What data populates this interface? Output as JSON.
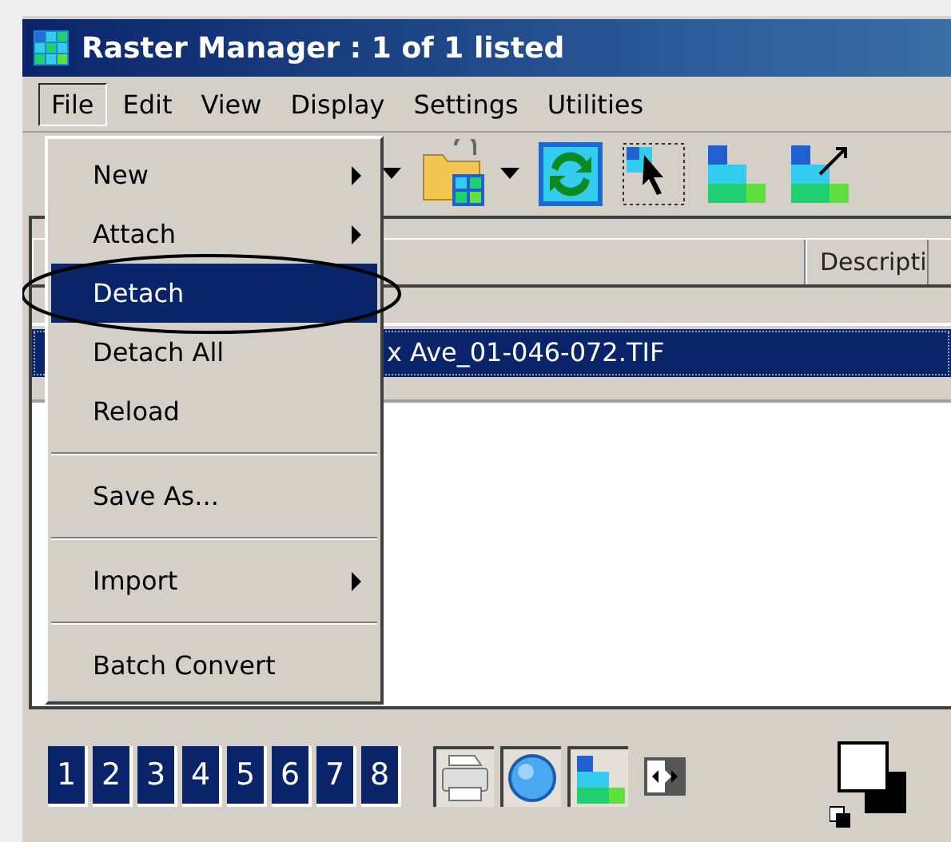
{
  "window": {
    "title": "Raster Manager : 1 of 1 listed"
  },
  "menu_bar": [
    {
      "label": "File",
      "selected": true
    },
    {
      "label": "Edit",
      "selected": false
    },
    {
      "label": "View",
      "selected": false
    },
    {
      "label": "Display",
      "selected": false
    },
    {
      "label": "Settings",
      "selected": false
    },
    {
      "label": "Utilities",
      "selected": false
    }
  ],
  "file_menu": {
    "items": [
      {
        "kind": "item",
        "label": "New",
        "submenu": true,
        "selected": false
      },
      {
        "kind": "item",
        "label": "Attach",
        "submenu": true,
        "selected": false
      },
      {
        "kind": "item",
        "label": "Detach",
        "submenu": false,
        "selected": true
      },
      {
        "kind": "item",
        "label": "Detach All",
        "submenu": false,
        "selected": false
      },
      {
        "kind": "item",
        "label": "Reload",
        "submenu": false,
        "selected": false
      },
      {
        "kind": "separator"
      },
      {
        "kind": "item",
        "label": "Save As...",
        "submenu": false,
        "selected": false
      },
      {
        "kind": "separator"
      },
      {
        "kind": "item",
        "label": "Import",
        "submenu": true,
        "selected": false
      },
      {
        "kind": "separator"
      },
      {
        "kind": "item",
        "label": "Batch Convert",
        "submenu": false,
        "selected": false
      }
    ]
  },
  "raster_list": {
    "columns": [
      "Descripti"
    ],
    "rows": [
      {
        "file": "x Ave_01-046-072.TIF",
        "selected": true
      }
    ]
  },
  "view_buttons": [
    "1",
    "2",
    "3",
    "4",
    "5",
    "6",
    "7",
    "8"
  ]
}
